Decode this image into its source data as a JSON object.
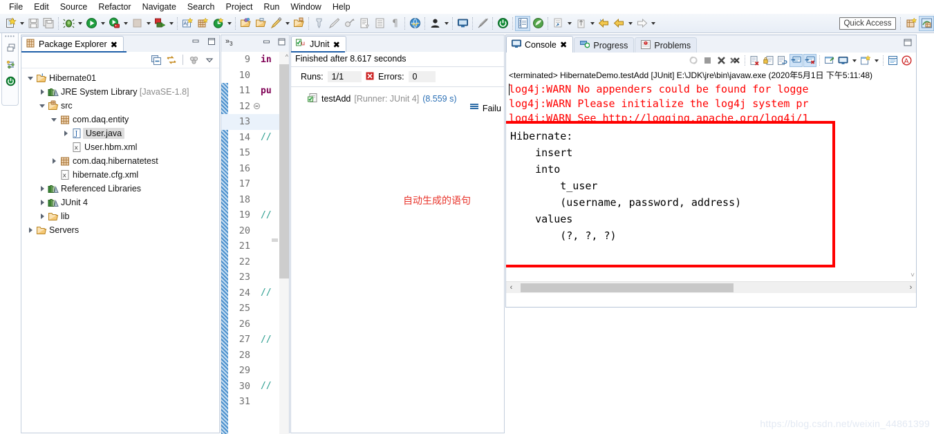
{
  "menubar": {
    "items": [
      "File",
      "Edit",
      "Source",
      "Refactor",
      "Navigate",
      "Search",
      "Project",
      "Run",
      "Window",
      "Help"
    ]
  },
  "toolbar": {
    "quick_access_placeholder": "Quick Access",
    "items": [
      {
        "name": "new-wizard-icon",
        "has_arrow": true
      },
      {
        "name": "save-icon",
        "has_arrow": false
      },
      {
        "name": "save-all-icon",
        "has_arrow": false
      },
      {
        "name": "debug-icon",
        "has_arrow": true
      },
      {
        "name": "run-icon",
        "has_arrow": true
      },
      {
        "name": "run-as-server-icon",
        "has_arrow": true
      },
      {
        "name": "stop-icon",
        "has_arrow": true
      },
      {
        "name": "external-tools-icon",
        "has_arrow": true
      },
      {
        "name": "new-java-package-icon",
        "has_arrow": false
      },
      {
        "name": "new-java-class-icon",
        "has_arrow": false
      },
      {
        "name": "refresh-icon",
        "has_arrow": true
      },
      {
        "name": "open-type-icon",
        "has_arrow": false
      },
      {
        "name": "open-task-icon",
        "has_arrow": false
      },
      {
        "name": "edit-icon",
        "has_arrow": true
      },
      {
        "name": "folder-open-icon",
        "has_arrow": false
      },
      {
        "name": "pin-icon",
        "has_arrow": false
      },
      {
        "name": "brush-icon",
        "has_arrow": false
      },
      {
        "name": "link-icon",
        "has_arrow": false
      },
      {
        "name": "document-icon",
        "has_arrow": false
      },
      {
        "name": "list-icon",
        "has_arrow": false
      },
      {
        "name": "paragraph-icon",
        "has_arrow": false
      },
      {
        "name": "web-browser-icon",
        "has_arrow": false
      },
      {
        "name": "user-icon",
        "has_arrow": true
      },
      {
        "name": "monitor-icon",
        "has_arrow": false
      },
      {
        "name": "no-annotation-icon",
        "has_arrow": false
      },
      {
        "name": "power-icon",
        "has_arrow": false
      },
      {
        "name": "outline-icon",
        "has_arrow": false
      },
      {
        "name": "spring-icon",
        "has_arrow": false
      },
      {
        "name": "report-icon",
        "has_arrow": true
      },
      {
        "name": "collapse-icon",
        "has_arrow": true
      },
      {
        "name": "back-icon",
        "has_arrow": false
      },
      {
        "name": "previous-icon",
        "has_arrow": true
      },
      {
        "name": "forward-icon",
        "has_arrow": true
      }
    ],
    "trailing": [
      {
        "name": "new-perspective-icon"
      },
      {
        "name": "java-perspective-icon"
      }
    ]
  },
  "fastview": {
    "items": [
      "restore-icon",
      "outline-view-icon",
      "servers-view-icon"
    ]
  },
  "package_explorer": {
    "tab_label": "Package Explorer",
    "close_glyph": "✖",
    "view_tools": [
      "collapse-all-icon",
      "link-with-editor-icon",
      "view-menu-icon",
      "view-dropdown-icon"
    ],
    "tree": [
      {
        "label": "Hibernate01",
        "sub": "",
        "depth": 0,
        "twist": "down",
        "icon": "java-project-icon",
        "selected": false
      },
      {
        "label": "JRE System Library",
        "sub": "[JavaSE-1.8]",
        "depth": 1,
        "twist": "right",
        "icon": "library-icon",
        "selected": false
      },
      {
        "label": "src",
        "sub": "",
        "depth": 1,
        "twist": "down",
        "icon": "source-folder-icon",
        "selected": false
      },
      {
        "label": "com.daq.entity",
        "sub": "",
        "depth": 2,
        "twist": "down",
        "icon": "package-icon",
        "selected": false
      },
      {
        "label": "User.java",
        "sub": "",
        "depth": 3,
        "twist": "right",
        "icon": "java-file-icon",
        "selected": true
      },
      {
        "label": "User.hbm.xml",
        "sub": "",
        "depth": 3,
        "twist": "none",
        "icon": "xml-file-icon",
        "selected": false
      },
      {
        "label": "com.daq.hibernatetest",
        "sub": "",
        "depth": 2,
        "twist": "right",
        "icon": "package-icon",
        "selected": false
      },
      {
        "label": "hibernate.cfg.xml",
        "sub": "",
        "depth": 2,
        "twist": "none",
        "icon": "xml-file-icon",
        "selected": false
      },
      {
        "label": "Referenced Libraries",
        "sub": "",
        "depth": 1,
        "twist": "right",
        "icon": "library-icon",
        "selected": false
      },
      {
        "label": "JUnit 4",
        "sub": "",
        "depth": 1,
        "twist": "right",
        "icon": "library-icon",
        "selected": false
      },
      {
        "label": "lib",
        "sub": "",
        "depth": 1,
        "twist": "right",
        "icon": "folder-icon",
        "selected": false
      },
      {
        "label": "Servers",
        "sub": "",
        "depth": 0,
        "twist": "right",
        "icon": "folder-icon",
        "selected": false
      }
    ]
  },
  "editor": {
    "chevron_label": "»",
    "hidden_tab_count": "3",
    "lines": [
      {
        "num": "9",
        "fold": "",
        "text": "in",
        "cls": "kw"
      },
      {
        "num": "10",
        "fold": "",
        "text": "",
        "cls": ""
      },
      {
        "num": "11",
        "fold": "",
        "text": "pu",
        "cls": "kw"
      },
      {
        "num": "12",
        "fold": "-",
        "text": "",
        "cls": ""
      },
      {
        "num": "13",
        "fold": "",
        "text": "",
        "cls": ""
      },
      {
        "num": "14",
        "fold": "",
        "text": "//",
        "cls": "cmt"
      },
      {
        "num": "15",
        "fold": "",
        "text": "",
        "cls": ""
      },
      {
        "num": "16",
        "fold": "",
        "text": "",
        "cls": ""
      },
      {
        "num": "17",
        "fold": "",
        "text": "",
        "cls": ""
      },
      {
        "num": "18",
        "fold": "",
        "text": "",
        "cls": ""
      },
      {
        "num": "19",
        "fold": "",
        "text": "//",
        "cls": "cmt"
      },
      {
        "num": "20",
        "fold": "",
        "text": "",
        "cls": ""
      },
      {
        "num": "21",
        "fold": "",
        "text": "",
        "cls": ""
      },
      {
        "num": "22",
        "fold": "",
        "text": "",
        "cls": ""
      },
      {
        "num": "23",
        "fold": "",
        "text": "",
        "cls": ""
      },
      {
        "num": "24",
        "fold": "",
        "text": "//",
        "cls": "cmt"
      },
      {
        "num": "25",
        "fold": "",
        "text": "",
        "cls": ""
      },
      {
        "num": "26",
        "fold": "",
        "text": "",
        "cls": ""
      },
      {
        "num": "27",
        "fold": "",
        "text": "//",
        "cls": "cmt"
      },
      {
        "num": "28",
        "fold": "",
        "text": "",
        "cls": ""
      },
      {
        "num": "29",
        "fold": "",
        "text": "",
        "cls": ""
      },
      {
        "num": "30",
        "fold": "",
        "text": "//",
        "cls": "cmt"
      },
      {
        "num": "31",
        "fold": "",
        "text": "",
        "cls": ""
      }
    ]
  },
  "junit": {
    "tab_label": "JUnit",
    "close_glyph": "✖",
    "status": "Finished after 8.617 seconds",
    "runs_label": "Runs:",
    "runs_value": "1/1",
    "errors_label": "Errors:",
    "errors_value": "0",
    "failures_label": "Failu",
    "test_name": "testAdd",
    "test_runner": "[Runner: JUnit 4]",
    "test_time": "(8.559 s)"
  },
  "console": {
    "tabs": [
      {
        "label": "Console",
        "icon": "console-icon",
        "active": true,
        "closable": true
      },
      {
        "label": "Progress",
        "icon": "progress-icon",
        "active": false,
        "closable": false
      },
      {
        "label": "Problems",
        "icon": "problems-icon",
        "active": false,
        "closable": false
      }
    ],
    "close_glyph": "✖",
    "toolbar": [
      {
        "name": "relaunch-icon",
        "active": false
      },
      {
        "name": "terminate-icon",
        "active": false
      },
      {
        "name": "remove-launch-icon",
        "active": false
      },
      {
        "name": "remove-all-terminated-icon",
        "active": false
      },
      {
        "name": "clear-console-icon",
        "active": false
      },
      {
        "name": "scroll-lock-icon",
        "active": false
      },
      {
        "name": "word-wrap-icon",
        "active": false
      },
      {
        "name": "show-console-on-output-icon",
        "active": true
      },
      {
        "name": "show-console-on-error-icon",
        "active": true
      },
      {
        "name": "pin-console-icon",
        "active": false
      },
      {
        "name": "display-selected-console-icon",
        "active": false
      },
      {
        "name": "open-console-icon",
        "active": false
      },
      {
        "name": "console-view-icon",
        "active": false
      },
      {
        "name": "alert-icon",
        "active": false
      }
    ],
    "terminated_line": "<terminated> HibernateDemo.testAdd [JUnit] E:\\JDK\\jre\\bin\\javaw.exe (2020年5月1日 下午5:11:48)",
    "warn_color": "#ff0000",
    "warnings": [
      "log4j:WARN No appenders could be found for logge",
      "log4j:WARN Please initialize the log4j system pr",
      "log4j:WARN See http://logging.apache.org/log4j/1"
    ],
    "sql_lines": [
      "Hibernate:",
      "    insert",
      "    into",
      "        t_user",
      "        (username, password, address)",
      "    values",
      "        (?, ?, ?)"
    ],
    "highlight_box_color": "#ff0000",
    "hscroll_left_glyph": "‹",
    "hscroll_right_glyph": "›"
  },
  "annotation": {
    "text": "自动生成的语句",
    "color": "#e8332a"
  },
  "watermark": {
    "text": "https://blog.csdn.net/weixin_44861399"
  }
}
